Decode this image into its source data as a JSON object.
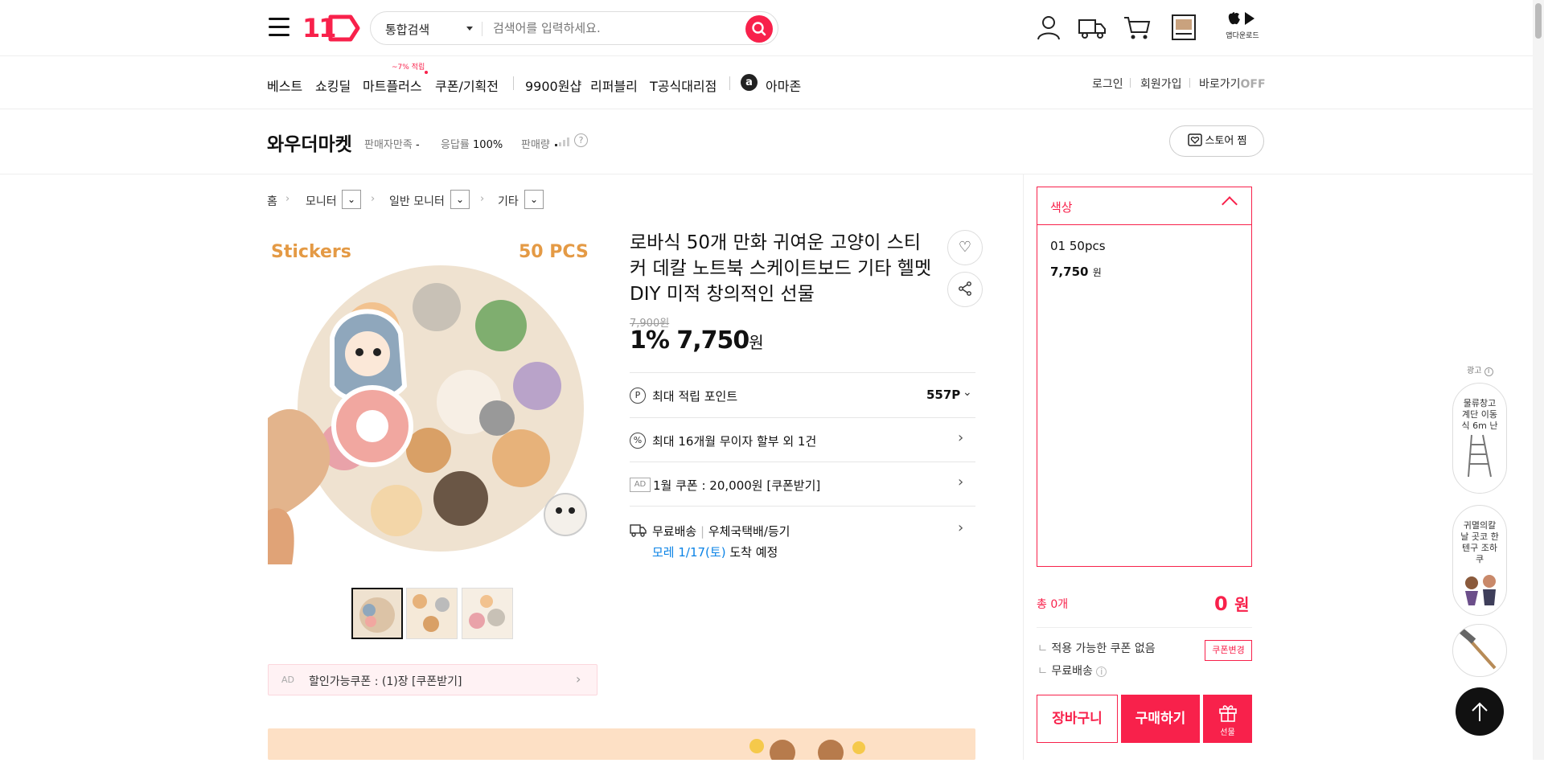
{
  "header": {
    "logo": "11",
    "search_scope": "통합검색",
    "search_placeholder": "검색어를 입력하세요.",
    "app_download": "앱다운로드",
    "icons": [
      "hamburger-menu-icon",
      "search-icon",
      "my-page-icon",
      "delivery-truck-icon",
      "cart-icon",
      "recent-view-icon",
      "app-store-icon"
    ]
  },
  "nav": {
    "items": [
      "베스트",
      "쇼킹딜",
      "마트플러스",
      "쿠폰/기획전",
      "9900원샵",
      "리퍼블리",
      "T공식대리점",
      "아마존"
    ],
    "mart_badge": "~7% 적립",
    "login": "로그인",
    "signup": "회원가입",
    "shortcut": "바로가기",
    "shortcut_state": "OFF"
  },
  "store": {
    "name": "와우더마켓",
    "satisfaction_label": "판매자만족",
    "satisfaction_value": "-",
    "response_label": "응답률",
    "response_value": "100%",
    "sales_label": "판매량",
    "store_button": "스토어 찜"
  },
  "breadcrumb": [
    "홈",
    "모니터",
    "일반 모니터",
    "기타"
  ],
  "product": {
    "title": "로바식 50개 만화 귀여운 고양이 스티커 데칼 노트북 스케이트보드 기타 헬멧 DIY 미적 창의적인 선물",
    "image_text_left": "Stickers",
    "image_text_right": "50 PCS",
    "original_price": "7,900원",
    "discount": "1%",
    "price": "7,750",
    "price_unit": "원",
    "points_label": "최대 적립 포인트",
    "points_value": "557P",
    "installment": "최대 16개월 무이자 할부 외 1건",
    "ad_tag": "AD",
    "coupon_offer": "1월 쿠폰 : 20,000원 [쿠폰받기]",
    "shipping_free": "무료배송",
    "shipping_method": "우체국택배/등기",
    "arrival_date": "모레 1/17(토)",
    "arrival_suffix": "도착 예정",
    "coupon_strip_ad": "AD",
    "coupon_strip": "할인가능쿠폰 : (1)장 [쿠폰받기]"
  },
  "option_panel": {
    "header": "색상",
    "option_name": "01 50pcs",
    "option_price": "7,750",
    "option_unit": "원",
    "total_label": "총 0개",
    "total_value": "0",
    "total_unit": "원",
    "no_coupon": "적용 가능한 쿠폰 없음",
    "coupon_change": "쿠폰변경",
    "free_shipping": "무료배송",
    "cart_button": "장바구니",
    "buy_button": "구매하기",
    "gift_button": "선물"
  },
  "side_ads": {
    "label": "광고",
    "ad1": "물류창고 계단 이동식 6m 난",
    "ad2": "귀멸의칼날 곳코 한텐구 조하쿠"
  },
  "colors": {
    "brand": "#f8214b",
    "link_blue": "#0b83e6"
  }
}
